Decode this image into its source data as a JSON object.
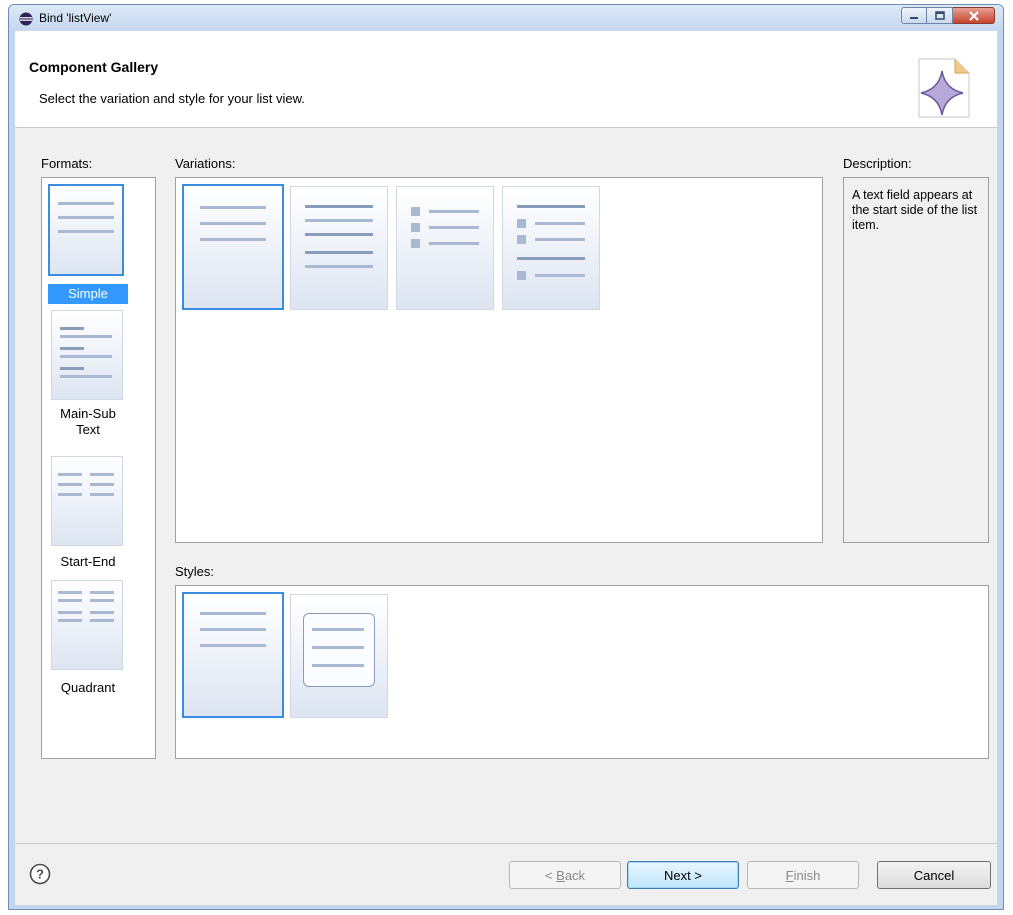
{
  "window": {
    "title": "Bind 'listView'"
  },
  "header": {
    "title": "Component Gallery",
    "message": "Select the variation and style for your list view."
  },
  "formats": {
    "label": "Formats:",
    "items": [
      {
        "label": "Simple",
        "selected": true
      },
      {
        "label": "Main-Sub Text",
        "selected": false
      },
      {
        "label": "Start-End",
        "selected": false
      },
      {
        "label": "Quadrant",
        "selected": false
      }
    ]
  },
  "variations": {
    "label": "Variations:",
    "count": 4,
    "selected_index": 0
  },
  "styles": {
    "label": "Styles:",
    "count": 2,
    "selected_index": 0
  },
  "description": {
    "label": "Description:",
    "text": "A text field appears at the start side of the list item."
  },
  "buttons": {
    "back": {
      "prefix": "< ",
      "mnemonic": "B",
      "rest": "ack",
      "enabled": false
    },
    "next": {
      "label": "Next >",
      "enabled": true
    },
    "finish": {
      "mnemonic": "F",
      "rest": "inish",
      "enabled": false
    },
    "cancel": {
      "label": "Cancel",
      "enabled": true
    }
  },
  "colors": {
    "selection": "#3399ff",
    "selected_border": "#3b8de0",
    "thumb_bar": "#a9b9d3"
  }
}
